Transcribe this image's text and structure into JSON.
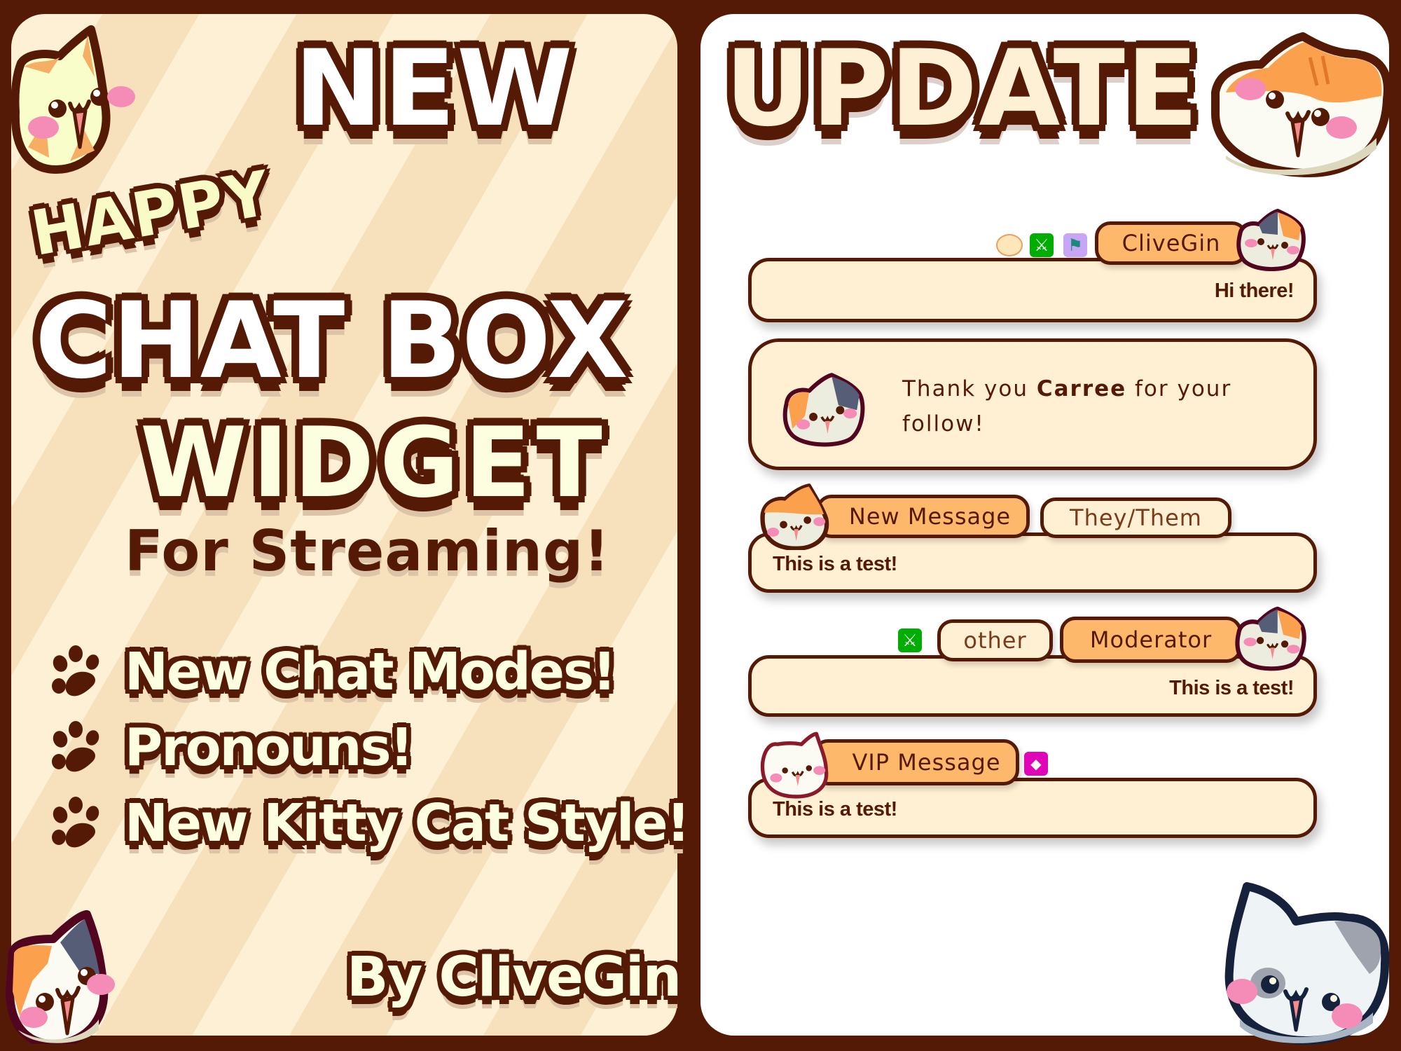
{
  "left_panel": {
    "title_new": "NEW",
    "title_happy": "HAPPY",
    "title_chatbox": "CHAT BOX",
    "title_widget": "WIDGET",
    "subtitle": "For Streaming!",
    "features": [
      {
        "icon": "paw-icon",
        "label": "New Chat Modes!"
      },
      {
        "icon": "paw-icon",
        "label": "Pronouns!"
      },
      {
        "icon": "paw-icon",
        "label": "New Kitty Cat Style!"
      }
    ],
    "byline": "By CliveGin"
  },
  "right_panel": {
    "title_update": "UPDATE",
    "chat_messages": [
      {
        "type": "chat",
        "align": "right",
        "username": "CliveGin",
        "badges": [
          "hamster-emote-badge",
          "moderator-sword-badge",
          "dino-sub-badge"
        ],
        "text": "Hi there!"
      },
      {
        "type": "follow",
        "text_before": "Thank you ",
        "name": "Carree",
        "text_after": " for your follow!"
      },
      {
        "type": "chat",
        "align": "left",
        "username": "New Message",
        "pronouns": "They/Them",
        "text": "This is a test!"
      },
      {
        "type": "chat",
        "align": "right",
        "username": "Moderator",
        "pronouns": "other",
        "badges": [
          "moderator-sword-badge"
        ],
        "text": "This is a test!"
      },
      {
        "type": "chat",
        "align": "left",
        "username": "VIP Message",
        "badges": [
          "vip-diamond-badge"
        ],
        "text": "This is a test!"
      }
    ]
  },
  "colors": {
    "border_brown": "#551a05",
    "cream": "#fff0d3",
    "stripe_light": "#fdf0d5",
    "stripe_dark": "#f7e1bd",
    "pill_orange": "#fdb86b",
    "mod_green": "#00ad03",
    "vip_pink": "#e005b9",
    "sub_purple": "#c9a5f5",
    "blush_pink": "#f58cb8"
  }
}
